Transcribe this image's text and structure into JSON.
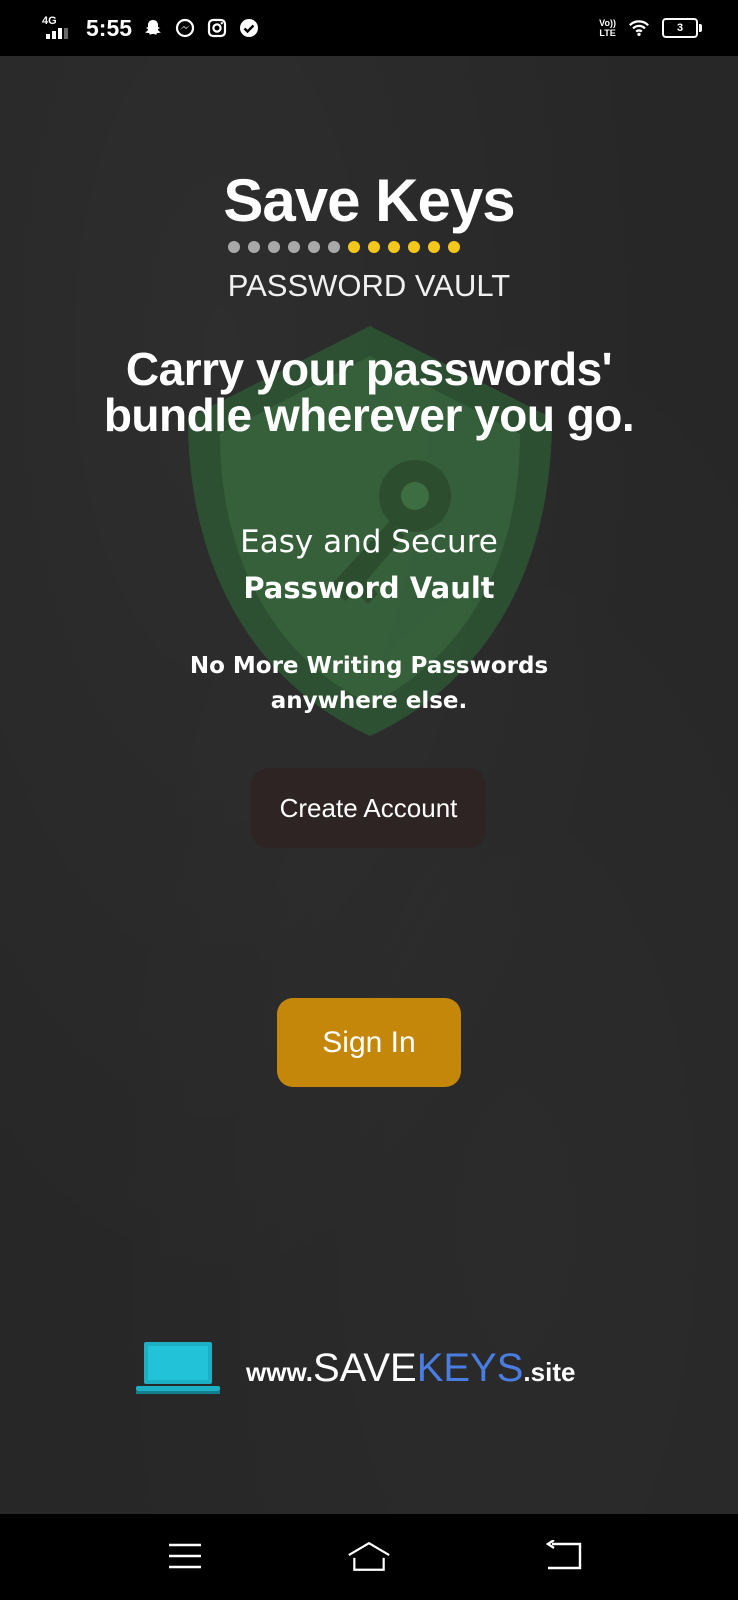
{
  "status_bar": {
    "network": "4G",
    "time": "5:55",
    "volte": "Vo))",
    "lte": "LTE",
    "battery": "3",
    "notification_icons": [
      "snapchat-icon",
      "messenger-icon",
      "instagram-icon",
      "check-circle-icon"
    ]
  },
  "brand": {
    "title": "Save Keys",
    "subtitle": "PASSWORD VAULT",
    "dot_colors": [
      "#a9a9a9",
      "#f3c81a"
    ]
  },
  "headline": "Carry your passwords' bundle wherever you go.",
  "tagline": {
    "line1": "Easy and Secure",
    "line2": "Password Vault"
  },
  "note": "No More Writing Passwords anywhere else.",
  "buttons": {
    "create_account": "Create Account",
    "sign_in": "Sign In"
  },
  "footer": {
    "www": "www.",
    "save": "SAVE",
    "keys": "KEYS",
    "tld": ".site"
  },
  "colors": {
    "sign_in": "#c58709",
    "create_account": "#2f2424",
    "keys_text": "#4a7de2",
    "shield": "#2f5c34"
  },
  "nav": {
    "icons": [
      "menu-icon",
      "home-icon",
      "back-icon"
    ]
  }
}
